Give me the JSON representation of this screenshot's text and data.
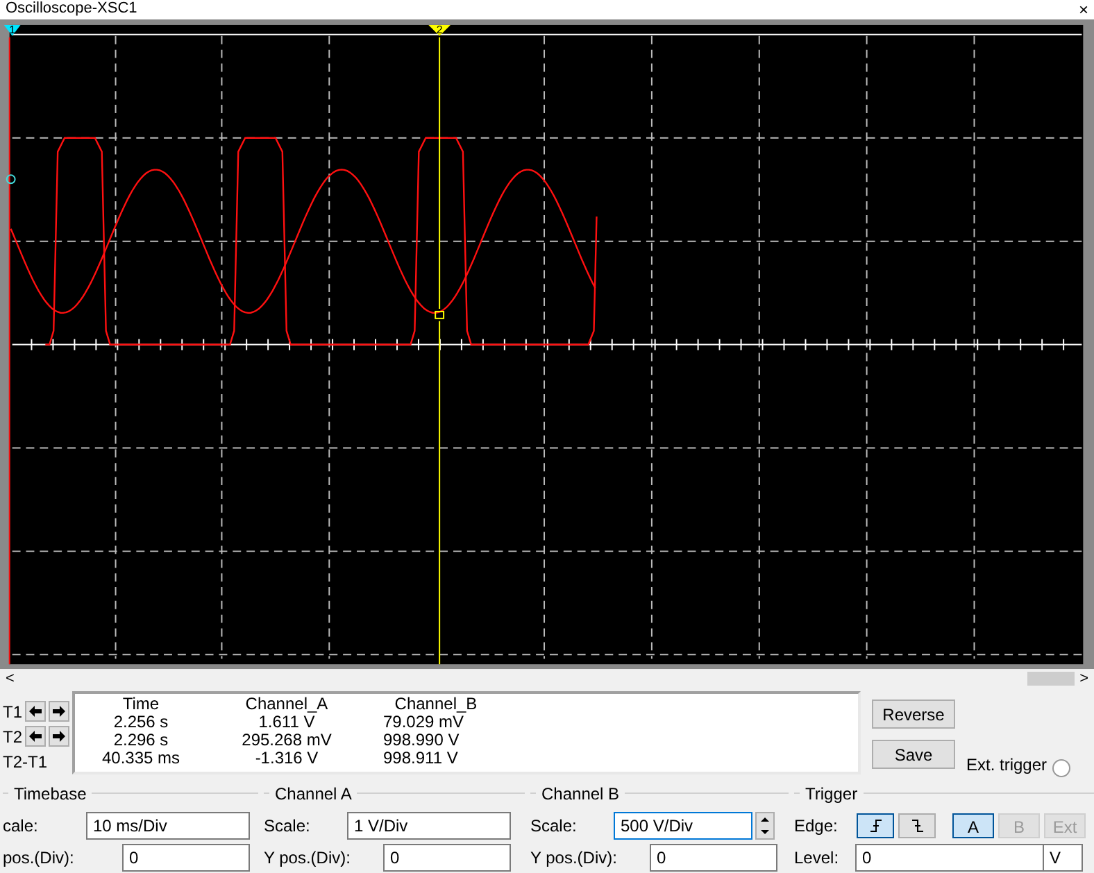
{
  "window": {
    "title": "Oscilloscope-XSC1",
    "close": "×"
  },
  "screen": {
    "cursors": [
      {
        "label": "1",
        "color": "#00e5ff"
      },
      {
        "label": "2",
        "color": "#ffff00"
      }
    ]
  },
  "scrollbar": {
    "left": "<",
    "right": ">"
  },
  "readout": {
    "headers": [
      "Time",
      "Channel_A",
      "Channel_B"
    ],
    "rows": [
      {
        "label": "T1",
        "kind": "cursor",
        "values": [
          "2.256 s",
          "1.611 V",
          "79.029 mV"
        ]
      },
      {
        "label": "T2",
        "kind": "cursor",
        "values": [
          "2.296 s",
          "295.268 mV",
          "998.990 V"
        ]
      },
      {
        "label": "T2-T1",
        "kind": "diff",
        "values": [
          "40.335 ms",
          "-1.316 V",
          "998.911 V"
        ]
      }
    ]
  },
  "buttons": [
    "Reverse",
    "Save"
  ],
  "ext_trigger": {
    "label": "Ext. trigger",
    "selected": false
  },
  "groups": [
    {
      "title": "Timebase",
      "scale_label": "cale:",
      "scale": "10 ms/Div",
      "ypos_label": "pos.(Div):",
      "ypos": "0",
      "focused": false,
      "spinner": false
    },
    {
      "title": "Channel A",
      "scale_label": "Scale:",
      "scale": "1  V/Div",
      "ypos_label": "Y pos.(Div):",
      "ypos": "0",
      "focused": false,
      "spinner": false
    },
    {
      "title": "Channel B",
      "scale_label": "Scale:",
      "scale": "500  V/Div",
      "ypos_label": "Y pos.(Div):",
      "ypos": "0",
      "focused": true,
      "spinner": true
    }
  ],
  "trigger": {
    "title": "Trigger",
    "edge_label": "Edge:",
    "edges": [
      {
        "kind": "rising",
        "selected": true
      },
      {
        "kind": "falling",
        "selected": false
      }
    ],
    "sources": [
      {
        "label": "A",
        "selected": true,
        "disabled": false
      },
      {
        "label": "B",
        "selected": false,
        "disabled": true
      },
      {
        "label": "Ext",
        "selected": false,
        "disabled": true
      }
    ],
    "level_label": "Level:",
    "level": "0",
    "unit": "V"
  }
}
